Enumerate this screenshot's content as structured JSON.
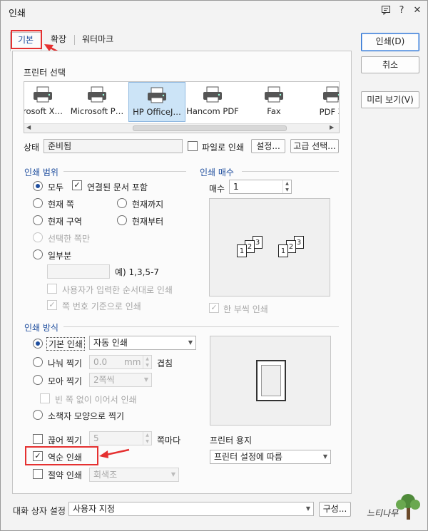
{
  "window": {
    "title": "인쇄"
  },
  "title_icons": [
    "notes-icon",
    "help-icon",
    "close-icon"
  ],
  "title_icon_glyphs": {
    "help": "?",
    "close": "✕"
  },
  "tabs": {
    "basic": "기본",
    "extended": "확장",
    "watermark": "워터마크"
  },
  "side_buttons": {
    "print": "인쇄(D)",
    "cancel": "취소",
    "preview": "미리 보기(V)"
  },
  "printer_select": {
    "label": "프린터 선택",
    "printers": [
      "rosoft X…",
      "Microsoft P…",
      "HP OfficeJ…",
      "Hancom PDF",
      "Fax",
      "PDF 저"
    ],
    "selected_index": 2
  },
  "status": {
    "label": "상태",
    "value": "준비됨",
    "to_file": "파일로 인쇄",
    "settings_button": "설정...",
    "advanced_button": "고급 선택..."
  },
  "print_range": {
    "title": "인쇄 범위",
    "all": "모두",
    "include_linked": "연결된 문서 포함",
    "current_page": "현재 쪽",
    "up_to_current": "현재까지",
    "current_section": "현재 구역",
    "from_current": "현재부터",
    "selected_pages": "선택한 쪽만",
    "partial": "일부분",
    "partial_value": "",
    "example": "예) 1,3,5-7",
    "user_order": "사용자가 입력한 순서대로 인쇄",
    "page_number_basis": "쪽 번호 기준으로 인쇄"
  },
  "copies": {
    "title": "인쇄 매수",
    "label": "매수",
    "value": "1",
    "collate": "한 부씩 인쇄"
  },
  "print_method": {
    "title": "인쇄 방식",
    "basic": "기본 인쇄",
    "basic_option": "자동 인쇄",
    "nup": "나눠 찍기",
    "nup_value": "0.0",
    "nup_unit": "mm",
    "overlap": "겹침",
    "collect": "모아 찍기",
    "collect_value": "2쪽씩",
    "no_blank": "빈 쪽 없이 이어서 인쇄",
    "booklet": "소책자 모양으로 찍기",
    "cut": "끊어 찍기",
    "cut_value": "5",
    "per_pages": "쪽마다",
    "reverse": "역순 인쇄",
    "saving": "절약 인쇄",
    "saving_value": "회색조"
  },
  "paper": {
    "label": "프린터 용지",
    "value": "프린터 설정에 따름"
  },
  "dialog_settings": {
    "label": "대화 상자 설정",
    "value": "사용자 지정",
    "button": "구성..."
  },
  "scroll_arrows": {
    "left": "◀",
    "right": "▶"
  },
  "combo_arrow": "▼",
  "spin_arrows": {
    "up": "▲",
    "down": "▼"
  },
  "check_mark": "✓",
  "copy_preview_pages": [
    "1",
    "2",
    "3"
  ],
  "watermark": {
    "text": "느티나무"
  },
  "colors": {
    "accent": "#1f4e9e",
    "annotation": "#e53030",
    "selection": "#cce4f7"
  }
}
